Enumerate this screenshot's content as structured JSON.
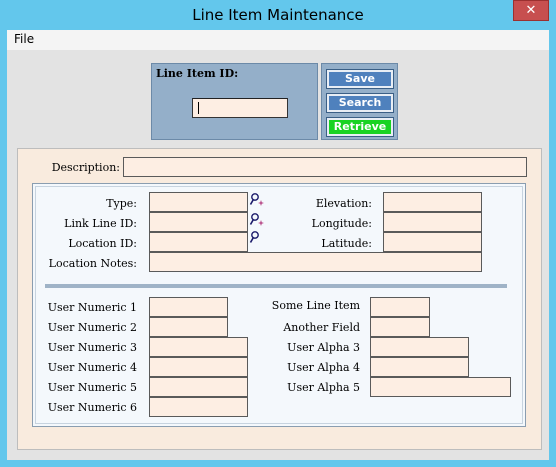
{
  "window": {
    "title": "Line Item Maintenance",
    "close_glyph": "✕"
  },
  "menu": {
    "file": "File"
  },
  "id_panel": {
    "label": "Line Item ID:",
    "value": ""
  },
  "buttons": {
    "save": "Save",
    "search": "Search",
    "retrieve": "Retrieve"
  },
  "form": {
    "description_label": "Description:",
    "type_label": "Type:",
    "link_line_label": "Link Line ID:",
    "location_id_label": "Location ID:",
    "location_notes_label": "Location Notes:",
    "elevation_label": "Elevation:",
    "longitude_label": "Longitude:",
    "latitude_label": "Latitude:",
    "user_numeric_1": "User Numeric 1",
    "user_numeric_2": "User Numeric 2",
    "user_numeric_3": "User Numeric 3",
    "user_numeric_4": "User Numeric 4",
    "user_numeric_5": "User Numeric 5",
    "user_numeric_6": "User Numeric 6",
    "some_line_item": "Some Line Item",
    "another_field": "Another Field",
    "user_alpha_3": "User Alpha 3",
    "user_alpha_4": "User Alpha 4",
    "user_alpha_5": "User Alpha 5"
  },
  "icons": {
    "lookup": "search-key-icon"
  }
}
